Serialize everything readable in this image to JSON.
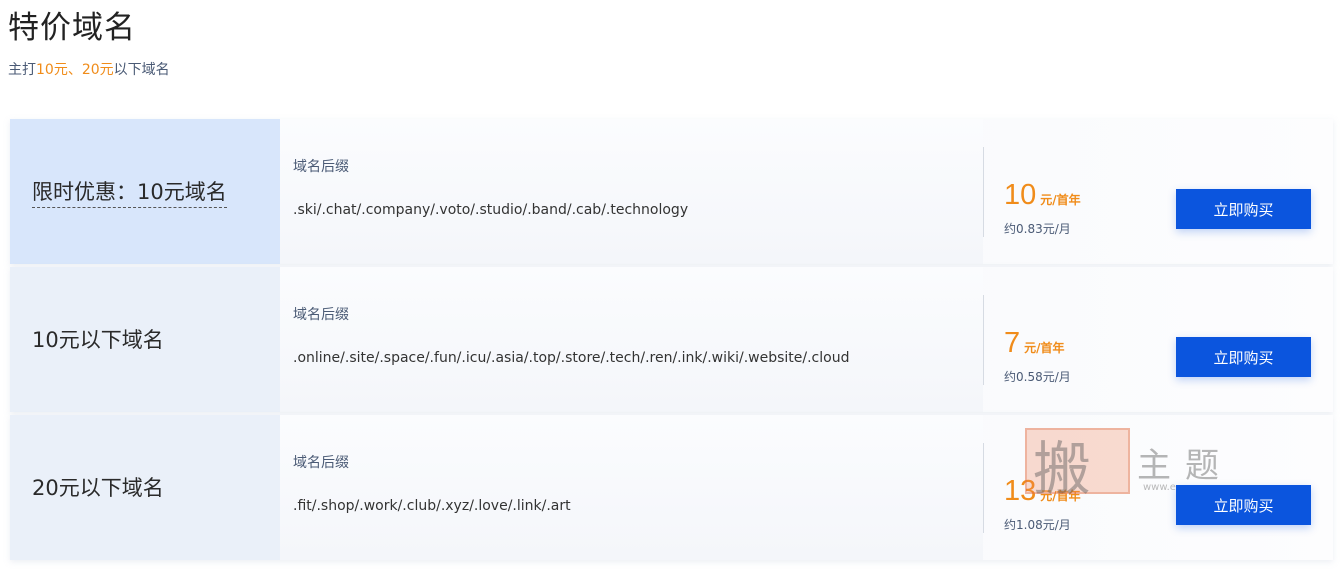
{
  "header": {
    "title": "特价域名",
    "subtitle_prefix": "主打",
    "subtitle_highlight1": "10元",
    "subtitle_sep": "、",
    "subtitle_highlight2": "20元",
    "subtitle_suffix": "以下域名"
  },
  "colors": {
    "accent_orange": "#f08c1a",
    "button_blue": "#0b55de",
    "active_row_bg": "#d8e6fb"
  },
  "rows": [
    {
      "label": "限时优惠：10元域名",
      "active": true,
      "suffix_title": "域名后缀",
      "suffixes": ".ski/.chat/.company/.voto/.studio/.band/.cab/.technology",
      "price": "10",
      "price_unit": "元/首年",
      "monthly": "约0.83元/月",
      "button_label": "立即购买"
    },
    {
      "label": "10元以下域名",
      "active": false,
      "suffix_title": "域名后缀",
      "suffixes": ".online/.site/.space/.fun/.icu/.asia/.top/.store/.tech/.ren/.ink/.wiki/.website/.cloud",
      "price": "7",
      "price_unit": "元/首年",
      "monthly": "约0.58元/月",
      "button_label": "立即购买"
    },
    {
      "label": "20元以下域名",
      "active": false,
      "suffix_title": "域名后缀",
      "suffixes": ".fit/.shop/.work/.club/.xyz/.love/.link/.art",
      "price": "13",
      "price_unit": "元/首年",
      "monthly": "约1.08元/月",
      "button_label": "立即购买"
    }
  ],
  "watermark": {
    "seal_char": "搬",
    "text": "主题",
    "url": "www.e"
  }
}
